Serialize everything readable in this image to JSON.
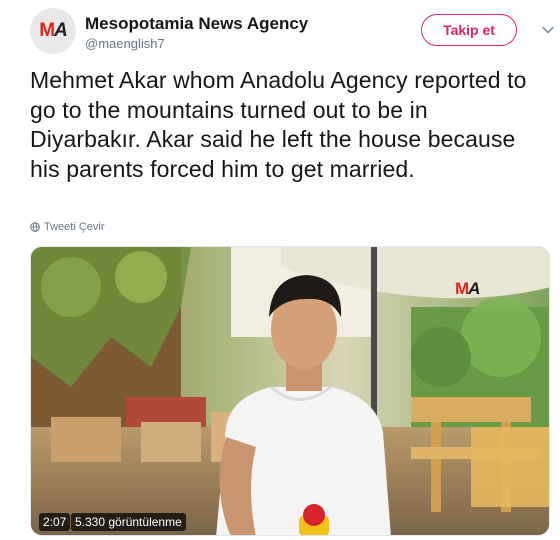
{
  "account": {
    "name": "Mesopotamia News Agency",
    "handle": "@maenglish7",
    "avatar_logo_text": "MA",
    "follow_label": "Takip et"
  },
  "tweet": {
    "text": "Mehmet Akar whom Anadolu Agency reported to go to the mountains turned out to be in Diyarbakır. Akar said he left the house because his parents forced him to get married.",
    "translate_label": "Tweeti Çevir"
  },
  "video": {
    "watermark_text": "MA",
    "duration": "2:07",
    "views": "5.330 görüntülenme"
  },
  "colors": {
    "follow_accent": "#e0245e",
    "logo_red": "#e0261c",
    "secondary_text": "#657786"
  },
  "icons": {
    "more": "chevron-down-icon",
    "translate": "globe-icon"
  }
}
